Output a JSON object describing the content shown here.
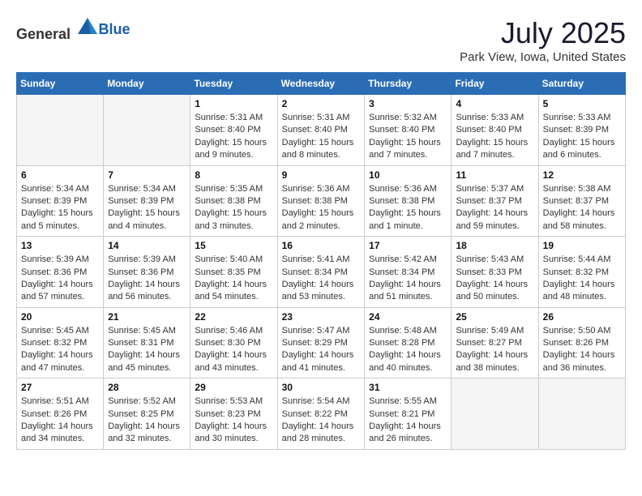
{
  "logo": {
    "general": "General",
    "blue": "Blue"
  },
  "title": "July 2025",
  "subtitle": "Park View, Iowa, United States",
  "headers": [
    "Sunday",
    "Monday",
    "Tuesday",
    "Wednesday",
    "Thursday",
    "Friday",
    "Saturday"
  ],
  "weeks": [
    [
      {
        "day": "",
        "empty": true
      },
      {
        "day": "",
        "empty": true
      },
      {
        "day": "1",
        "sunrise": "Sunrise: 5:31 AM",
        "sunset": "Sunset: 8:40 PM",
        "daylight": "Daylight: 15 hours and 9 minutes."
      },
      {
        "day": "2",
        "sunrise": "Sunrise: 5:31 AM",
        "sunset": "Sunset: 8:40 PM",
        "daylight": "Daylight: 15 hours and 8 minutes."
      },
      {
        "day": "3",
        "sunrise": "Sunrise: 5:32 AM",
        "sunset": "Sunset: 8:40 PM",
        "daylight": "Daylight: 15 hours and 7 minutes."
      },
      {
        "day": "4",
        "sunrise": "Sunrise: 5:33 AM",
        "sunset": "Sunset: 8:40 PM",
        "daylight": "Daylight: 15 hours and 7 minutes."
      },
      {
        "day": "5",
        "sunrise": "Sunrise: 5:33 AM",
        "sunset": "Sunset: 8:39 PM",
        "daylight": "Daylight: 15 hours and 6 minutes."
      }
    ],
    [
      {
        "day": "6",
        "sunrise": "Sunrise: 5:34 AM",
        "sunset": "Sunset: 8:39 PM",
        "daylight": "Daylight: 15 hours and 5 minutes."
      },
      {
        "day": "7",
        "sunrise": "Sunrise: 5:34 AM",
        "sunset": "Sunset: 8:39 PM",
        "daylight": "Daylight: 15 hours and 4 minutes."
      },
      {
        "day": "8",
        "sunrise": "Sunrise: 5:35 AM",
        "sunset": "Sunset: 8:38 PM",
        "daylight": "Daylight: 15 hours and 3 minutes."
      },
      {
        "day": "9",
        "sunrise": "Sunrise: 5:36 AM",
        "sunset": "Sunset: 8:38 PM",
        "daylight": "Daylight: 15 hours and 2 minutes."
      },
      {
        "day": "10",
        "sunrise": "Sunrise: 5:36 AM",
        "sunset": "Sunset: 8:38 PM",
        "daylight": "Daylight: 15 hours and 1 minute."
      },
      {
        "day": "11",
        "sunrise": "Sunrise: 5:37 AM",
        "sunset": "Sunset: 8:37 PM",
        "daylight": "Daylight: 14 hours and 59 minutes."
      },
      {
        "day": "12",
        "sunrise": "Sunrise: 5:38 AM",
        "sunset": "Sunset: 8:37 PM",
        "daylight": "Daylight: 14 hours and 58 minutes."
      }
    ],
    [
      {
        "day": "13",
        "sunrise": "Sunrise: 5:39 AM",
        "sunset": "Sunset: 8:36 PM",
        "daylight": "Daylight: 14 hours and 57 minutes."
      },
      {
        "day": "14",
        "sunrise": "Sunrise: 5:39 AM",
        "sunset": "Sunset: 8:36 PM",
        "daylight": "Daylight: 14 hours and 56 minutes."
      },
      {
        "day": "15",
        "sunrise": "Sunrise: 5:40 AM",
        "sunset": "Sunset: 8:35 PM",
        "daylight": "Daylight: 14 hours and 54 minutes."
      },
      {
        "day": "16",
        "sunrise": "Sunrise: 5:41 AM",
        "sunset": "Sunset: 8:34 PM",
        "daylight": "Daylight: 14 hours and 53 minutes."
      },
      {
        "day": "17",
        "sunrise": "Sunrise: 5:42 AM",
        "sunset": "Sunset: 8:34 PM",
        "daylight": "Daylight: 14 hours and 51 minutes."
      },
      {
        "day": "18",
        "sunrise": "Sunrise: 5:43 AM",
        "sunset": "Sunset: 8:33 PM",
        "daylight": "Daylight: 14 hours and 50 minutes."
      },
      {
        "day": "19",
        "sunrise": "Sunrise: 5:44 AM",
        "sunset": "Sunset: 8:32 PM",
        "daylight": "Daylight: 14 hours and 48 minutes."
      }
    ],
    [
      {
        "day": "20",
        "sunrise": "Sunrise: 5:45 AM",
        "sunset": "Sunset: 8:32 PM",
        "daylight": "Daylight: 14 hours and 47 minutes."
      },
      {
        "day": "21",
        "sunrise": "Sunrise: 5:45 AM",
        "sunset": "Sunset: 8:31 PM",
        "daylight": "Daylight: 14 hours and 45 minutes."
      },
      {
        "day": "22",
        "sunrise": "Sunrise: 5:46 AM",
        "sunset": "Sunset: 8:30 PM",
        "daylight": "Daylight: 14 hours and 43 minutes."
      },
      {
        "day": "23",
        "sunrise": "Sunrise: 5:47 AM",
        "sunset": "Sunset: 8:29 PM",
        "daylight": "Daylight: 14 hours and 41 minutes."
      },
      {
        "day": "24",
        "sunrise": "Sunrise: 5:48 AM",
        "sunset": "Sunset: 8:28 PM",
        "daylight": "Daylight: 14 hours and 40 minutes."
      },
      {
        "day": "25",
        "sunrise": "Sunrise: 5:49 AM",
        "sunset": "Sunset: 8:27 PM",
        "daylight": "Daylight: 14 hours and 38 minutes."
      },
      {
        "day": "26",
        "sunrise": "Sunrise: 5:50 AM",
        "sunset": "Sunset: 8:26 PM",
        "daylight": "Daylight: 14 hours and 36 minutes."
      }
    ],
    [
      {
        "day": "27",
        "sunrise": "Sunrise: 5:51 AM",
        "sunset": "Sunset: 8:26 PM",
        "daylight": "Daylight: 14 hours and 34 minutes."
      },
      {
        "day": "28",
        "sunrise": "Sunrise: 5:52 AM",
        "sunset": "Sunset: 8:25 PM",
        "daylight": "Daylight: 14 hours and 32 minutes."
      },
      {
        "day": "29",
        "sunrise": "Sunrise: 5:53 AM",
        "sunset": "Sunset: 8:23 PM",
        "daylight": "Daylight: 14 hours and 30 minutes."
      },
      {
        "day": "30",
        "sunrise": "Sunrise: 5:54 AM",
        "sunset": "Sunset: 8:22 PM",
        "daylight": "Daylight: 14 hours and 28 minutes."
      },
      {
        "day": "31",
        "sunrise": "Sunrise: 5:55 AM",
        "sunset": "Sunset: 8:21 PM",
        "daylight": "Daylight: 14 hours and 26 minutes."
      },
      {
        "day": "",
        "empty": true
      },
      {
        "day": "",
        "empty": true
      }
    ]
  ]
}
